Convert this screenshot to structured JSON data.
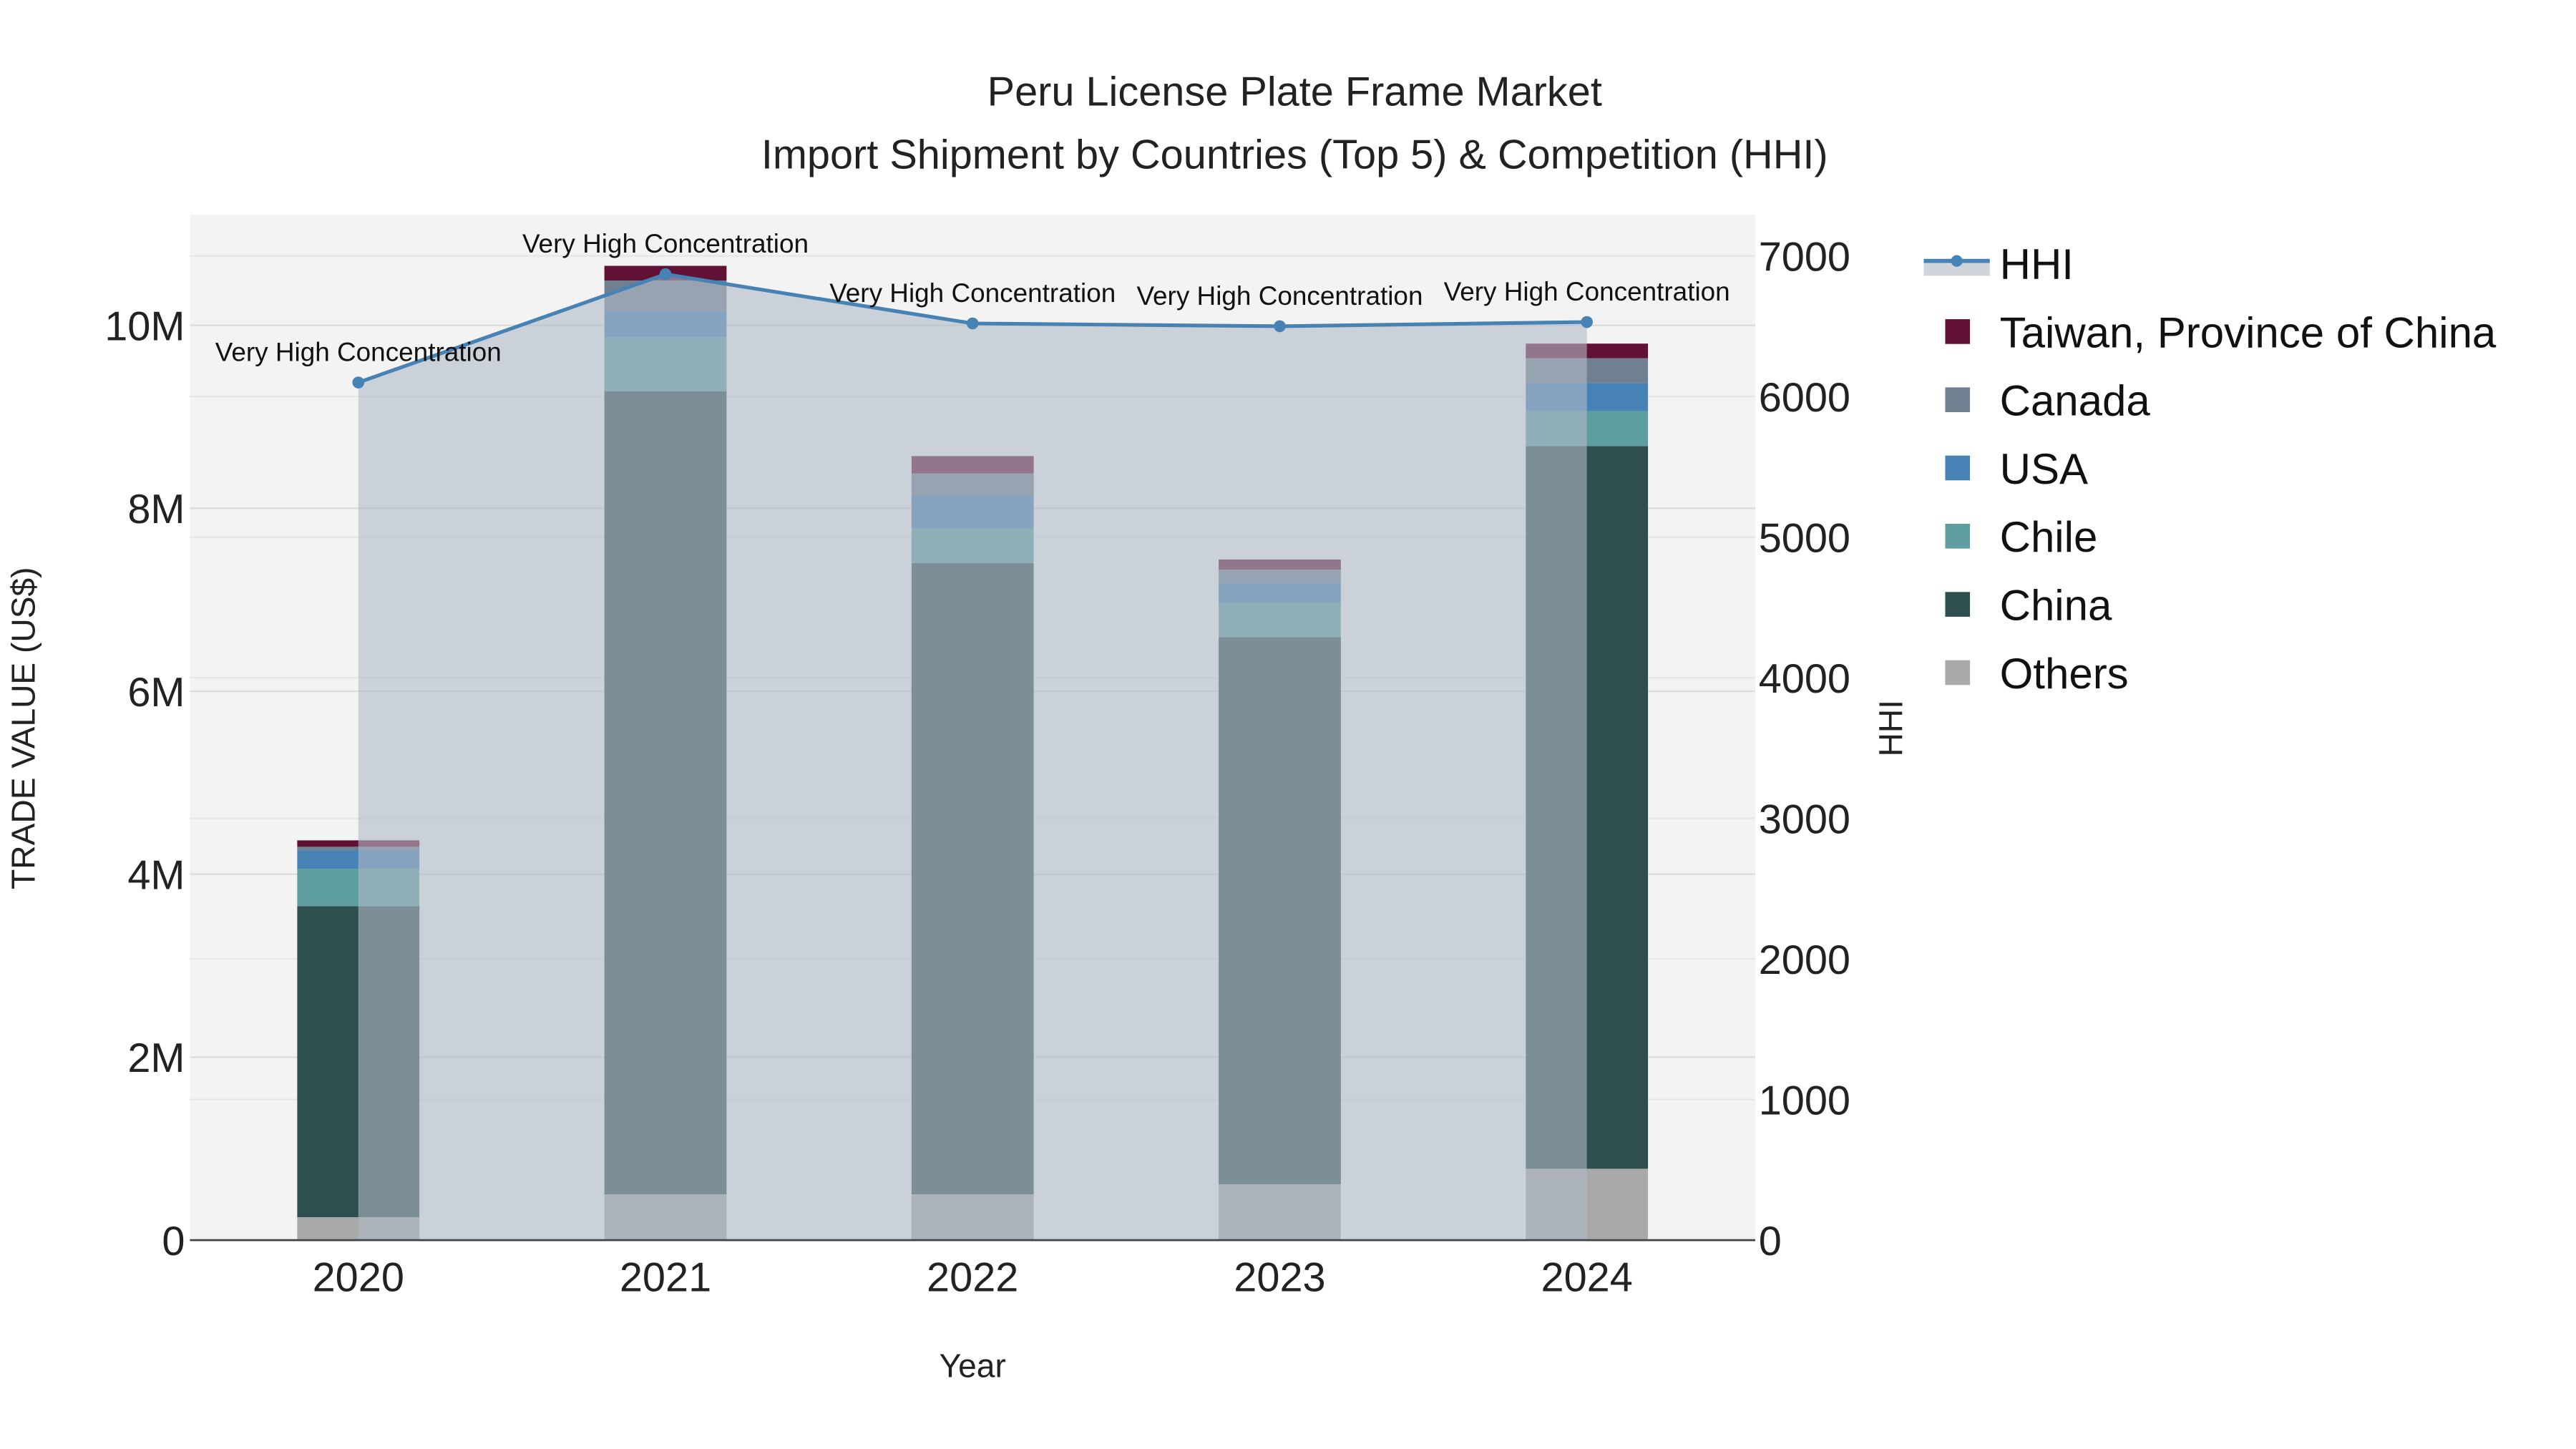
{
  "chart_data": {
    "type": "bar",
    "stacked": true,
    "title_line1": "Peru License Plate Frame Market",
    "title_line2": "Import Shipment by Countries (Top 5) & Competition (HHI)",
    "xlabel": "Year",
    "ylabel": "TRADE VALUE (US$)",
    "y2label": "HHI",
    "categories": [
      "2020",
      "2021",
      "2022",
      "2023",
      "2024"
    ],
    "ylim": [
      0,
      11200000
    ],
    "y_ticks": [
      0,
      2000000,
      4000000,
      6000000,
      8000000,
      10000000
    ],
    "y_tick_labels": [
      "0",
      "2M",
      "4M",
      "6M",
      "8M",
      "10M"
    ],
    "y2lim": [
      0,
      7300
    ],
    "y2_ticks": [
      0,
      1000,
      2000,
      3000,
      4000,
      5000,
      6000,
      7000
    ],
    "y2_tick_labels": [
      "0",
      "1000",
      "2000",
      "3000",
      "4000",
      "5000",
      "6000",
      "7000"
    ],
    "grid": true,
    "legend_position": "right",
    "series": [
      {
        "name": "Others",
        "color": "#a9a9a9",
        "values": [
          250000,
          500000,
          500000,
          610000,
          780000
        ]
      },
      {
        "name": "China",
        "color": "#2f4f4f",
        "values": [
          3400000,
          8780000,
          6900000,
          5980000,
          7900000
        ]
      },
      {
        "name": "Chile",
        "color": "#5f9ea0",
        "values": [
          410000,
          590000,
          380000,
          380000,
          380000
        ]
      },
      {
        "name": "USA",
        "color": "#4682b4",
        "values": [
          200000,
          290000,
          360000,
          210000,
          310000
        ]
      },
      {
        "name": "Canada",
        "color": "#708090",
        "values": [
          40000,
          330000,
          240000,
          150000,
          270000
        ]
      },
      {
        "name": "Taiwan, Province of China",
        "color": "#611134",
        "values": [
          70000,
          160000,
          190000,
          110000,
          160000
        ]
      }
    ],
    "hhi": {
      "name": "HHI",
      "color": "#4682b4",
      "values": [
        6100,
        6870,
        6520,
        6500,
        6530
      ],
      "annotations": [
        "Very High Concentration",
        "Very High Concentration",
        "Very High Concentration",
        "Very High Concentration",
        "Very High Concentration"
      ]
    },
    "legend_order": [
      "HHI",
      "Taiwan, Province of China",
      "Canada",
      "USA",
      "Chile",
      "China",
      "Others"
    ]
  }
}
